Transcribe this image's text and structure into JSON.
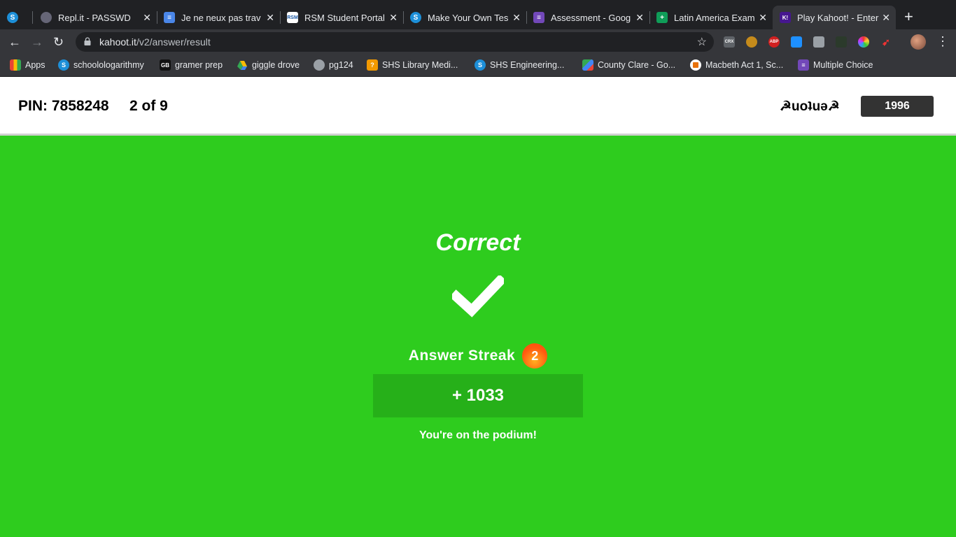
{
  "browser": {
    "tabs": [
      {
        "icon": "schoology-icon",
        "title": ""
      },
      {
        "icon": "replit-icon",
        "title": "Repl.it - PASSWD"
      },
      {
        "icon": "google-docs-icon",
        "title": "Je ne neux pas trav"
      },
      {
        "icon": "rsm-icon",
        "title": "RSM Student Portal"
      },
      {
        "icon": "schoology-icon",
        "title": "Make Your Own Tes"
      },
      {
        "icon": "google-forms-icon",
        "title": "Assessment - Goog"
      },
      {
        "icon": "google-sheets-icon",
        "title": "Latin America Exam"
      },
      {
        "icon": "kahoot-icon",
        "title": "Play Kahoot! - Enter"
      }
    ],
    "url_host": "kahoot.it",
    "url_path": "/v2/answer/result",
    "extensions": [
      "CRX",
      "ABP"
    ],
    "bookmarks": [
      {
        "icon": "apps-grid-icon",
        "label": "Apps"
      },
      {
        "icon": "schoology-icon",
        "label": "schoolologarithmy"
      },
      {
        "icon": "gb-icon",
        "label": "gramer prep"
      },
      {
        "icon": "google-drive-icon",
        "label": "giggle drove"
      },
      {
        "icon": "globe-icon",
        "label": "pg124"
      },
      {
        "icon": "library-icon",
        "label": "SHS Library Medi..."
      },
      {
        "icon": "schoology-icon",
        "label": "SHS Engineering..."
      },
      {
        "icon": "google-maps-icon",
        "label": "County Clare - Go..."
      },
      {
        "icon": "chart-icon",
        "label": "Macbeth Act 1, Sc..."
      },
      {
        "icon": "google-forms-icon",
        "label": "Multiple Choice"
      }
    ]
  },
  "game": {
    "pin_label": "PIN: 7858248",
    "question_progress": "2 of 9",
    "nickname": "☭uoʇuǝ☭",
    "score": "1996"
  },
  "result": {
    "title": "Correct",
    "streak_label": "Answer Streak",
    "streak_count": "2",
    "points": "+ 1033",
    "message": "You're on the podium!"
  },
  "colors": {
    "background": "#2ecc1e",
    "points_box": "#26b019",
    "score_box": "#333333"
  }
}
